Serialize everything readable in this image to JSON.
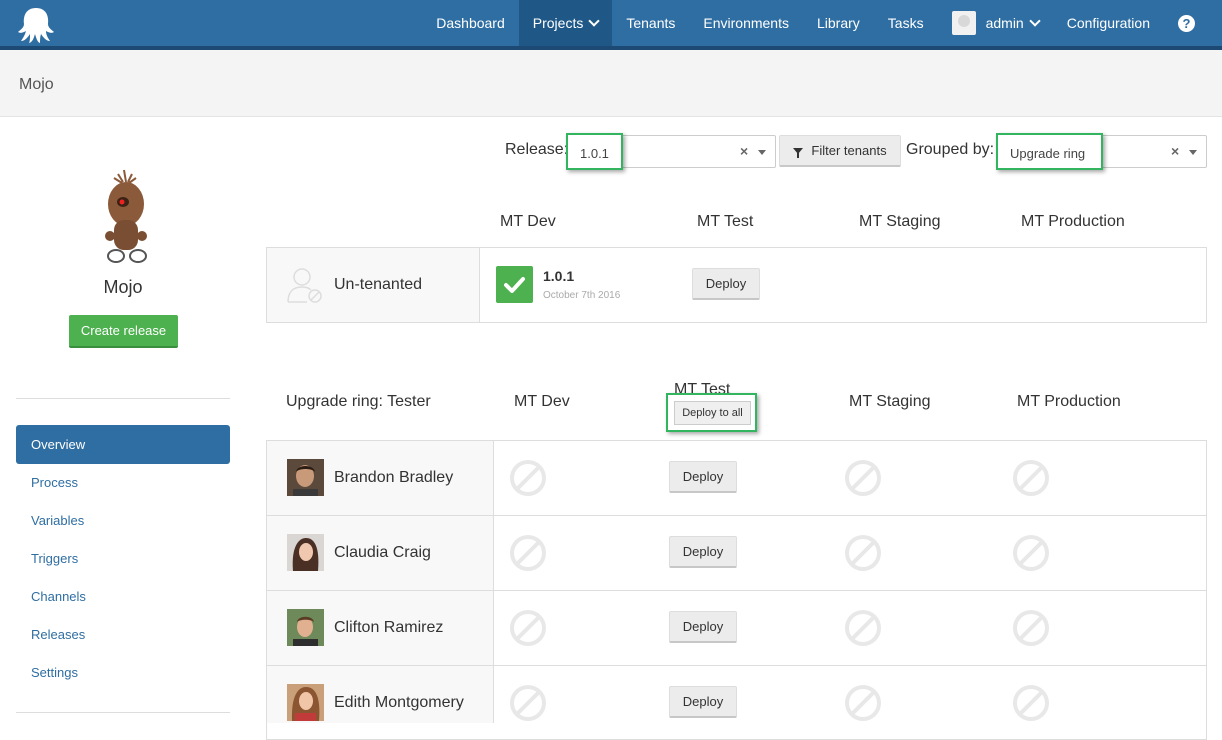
{
  "nav": {
    "items": [
      "Dashboard",
      "Projects",
      "Tenants",
      "Environments",
      "Library",
      "Tasks"
    ],
    "user": "admin",
    "configuration": "Configuration",
    "help": "?"
  },
  "page": {
    "title": "Mojo"
  },
  "sidebar": {
    "project_name": "Mojo",
    "create_release": "Create release",
    "items": [
      "Overview",
      "Process",
      "Variables",
      "Triggers",
      "Channels",
      "Releases",
      "Settings"
    ],
    "active": "Overview"
  },
  "filters": {
    "release_label": "Release:",
    "release_value": "1.0.1",
    "clear": "×",
    "filter_button": "Filter tenants",
    "grouped_label": "Grouped by:",
    "grouped_value": "Upgrade ring"
  },
  "environments": [
    "MT Dev",
    "MT Test",
    "MT Staging",
    "MT Production"
  ],
  "untenanted": {
    "label": "Un-tenanted",
    "release": "1.0.1",
    "date": "October 7th 2016",
    "deploy": "Deploy"
  },
  "group": {
    "title": "Upgrade ring: Tester",
    "deploy_to_all": "Deploy to all",
    "tenants": [
      {
        "name": "Brandon Bradley",
        "deploy": "Deploy"
      },
      {
        "name": "Claudia Craig",
        "deploy": "Deploy"
      },
      {
        "name": "Clifton Ramirez",
        "deploy": "Deploy"
      },
      {
        "name": "Edith Montgomery",
        "deploy": "Deploy"
      }
    ]
  },
  "colors": {
    "nav": "#2f6ea2",
    "success": "#4cb14e",
    "highlight": "#33b560"
  }
}
